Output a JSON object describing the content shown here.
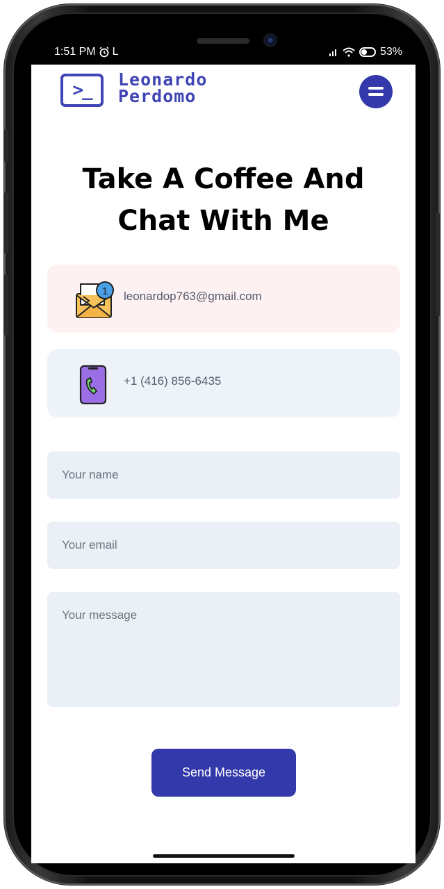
{
  "status_bar": {
    "time": "1:51 PM",
    "left_icons": [
      "alarm-icon",
      "letter-l"
    ],
    "left_letter": "L",
    "battery_percent": "53%",
    "right_icons": [
      "signal-icon",
      "wifi-icon",
      "battery-icon"
    ]
  },
  "header": {
    "logo_symbol": ">_",
    "logo_line1": "Leonardo",
    "logo_line2": "Perdomo",
    "menu_icon": "hamburger-icon"
  },
  "page": {
    "title_line1": "Take A Coffee And",
    "title_line2": "Chat With Me"
  },
  "contacts": {
    "email": "leonardop763@gmail.com",
    "email_badge": "1",
    "phone": "+1 (416) 856-6435"
  },
  "form": {
    "name_placeholder": "Your name",
    "email_placeholder": "Your email",
    "message_placeholder": "Your message",
    "submit_label": "Send Message"
  },
  "colors": {
    "brand": "#3338aa",
    "email_card": "#fdf1f1",
    "phone_card": "#eef3fa",
    "field_bg": "#ebf0f7"
  }
}
